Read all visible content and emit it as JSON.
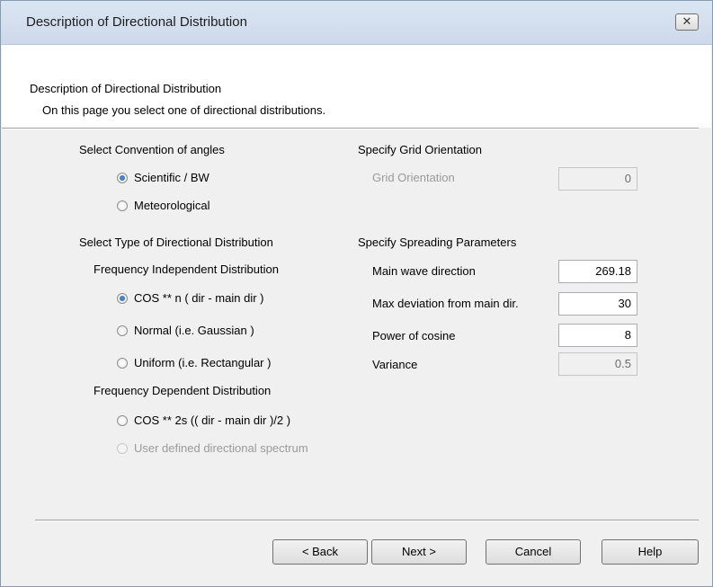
{
  "window": {
    "title": "Description of Directional Distribution",
    "close_glyph": "✕"
  },
  "header": {
    "title": "Description of Directional Distribution",
    "subtitle": "On this page you select one of directional distributions."
  },
  "angles": {
    "heading": "Select Convention of angles",
    "options": [
      {
        "label": "Scientific / BW",
        "checked": true
      },
      {
        "label": "Meteorological",
        "checked": false
      }
    ]
  },
  "grid": {
    "heading": "Specify Grid Orientation",
    "label": "Grid Orientation",
    "value": "0"
  },
  "distribution": {
    "heading": "Select Type of Directional Distribution",
    "independent_heading": "Frequency Independent Distribution",
    "independent_options": [
      {
        "label": "COS ** n ( dir - main dir )",
        "checked": true
      },
      {
        "label": "Normal (i.e. Gaussian )",
        "checked": false
      },
      {
        "label": "Uniform (i.e. Rectangular )",
        "checked": false
      }
    ],
    "dependent_heading": "Frequency Dependent Distribution",
    "dependent_options": [
      {
        "label": "COS ** 2s (( dir - main dir )/2 )",
        "checked": false,
        "disabled": false
      },
      {
        "label": "User defined directional spectrum",
        "checked": false,
        "disabled": true
      }
    ]
  },
  "spreading": {
    "heading": "Specify Spreading Parameters",
    "params": [
      {
        "label": "Main wave direction",
        "value": "269.18",
        "readonly": false
      },
      {
        "label": "Max deviation from main dir.",
        "value": "30",
        "readonly": false
      },
      {
        "label": "Power of cosine",
        "value": "8",
        "readonly": false
      },
      {
        "label": "Variance",
        "value": "0.5",
        "readonly": true
      }
    ]
  },
  "buttons": {
    "back": "< Back",
    "next": "Next >",
    "cancel": "Cancel",
    "help": "Help"
  }
}
